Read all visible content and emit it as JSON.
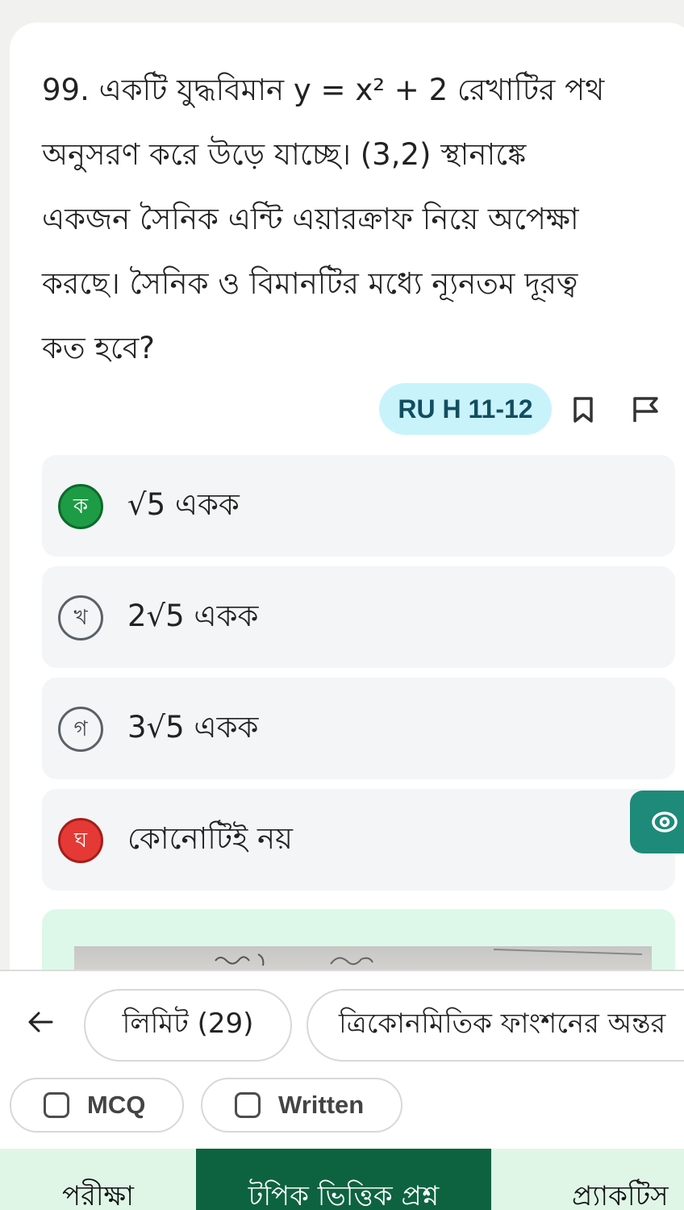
{
  "question": {
    "lines": [
      "99. একটি যুদ্ধবিমান y = x² + 2 রেখাটির পথ",
      "অনুসরণ করে উড়ে যাচ্ছে। (3,2) স্থানাঙ্কে",
      "একজন সৈনিক এন্টি এয়ারক্রাফ নিয়ে অপেক্ষা",
      "করছে। সৈনিক ও বিমানটির মধ্যে ন্যূনতম দূরত্ব",
      "কত হবে?"
    ]
  },
  "tag": "RU H 11-12",
  "options": [
    {
      "badge": "ক",
      "text": "√5 একক",
      "state": "correct"
    },
    {
      "badge": "খ",
      "text": "2√5 একক",
      "state": "plain"
    },
    {
      "badge": "গ",
      "text": "3√5 একক",
      "state": "plain"
    },
    {
      "badge": "ঘ",
      "text": "কোনোটিই নয়",
      "state": "wrong"
    }
  ],
  "chips": {
    "limit": "লিমিট (29)",
    "topic": "ত্রিকোনমিতিক ফাংশনের অন্তর"
  },
  "filters": {
    "mcq": "MCQ",
    "written": "Written"
  },
  "nav": {
    "exam": "পরীক্ষা",
    "topic_questions": "টপিক ভিত্তিক প্রশ্ন",
    "practice": "প্র্যাকটিস"
  },
  "colors": {
    "correct": "#1e9b45",
    "wrong": "#e53935",
    "tag_bg": "#c9f3fb",
    "eye_button": "#1e8a79",
    "nav_active": "#0d6340",
    "explain_bg": "#ddf8e9"
  },
  "icons": {
    "bookmark": "bookmark-icon",
    "flag": "flag-icon",
    "eye": "eye-icon",
    "back": "arrow-left-icon"
  }
}
